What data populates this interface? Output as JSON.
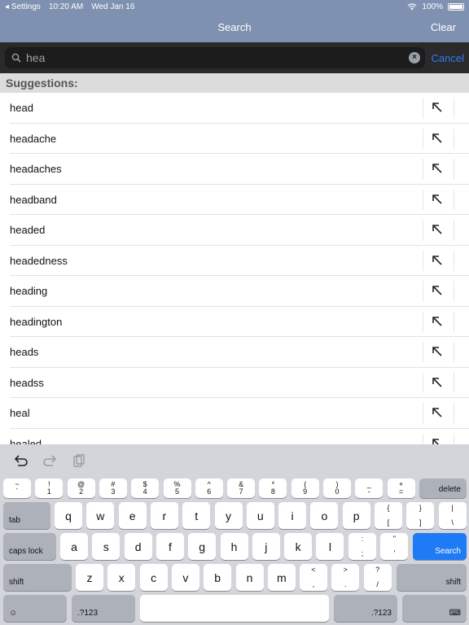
{
  "status_bar": {
    "back_label": "◂ Settings",
    "time": "10:20 AM",
    "date": "Wed Jan 16",
    "battery": "100%"
  },
  "nav": {
    "title": "Search",
    "clear_label": "Clear"
  },
  "search": {
    "value": "hea",
    "cancel_label": "Cancel"
  },
  "suggestions": {
    "header": "Suggestions:",
    "items": [
      "head",
      "headache",
      "headaches",
      "headband",
      "headed",
      "headedness",
      "heading",
      "headington",
      "heads",
      "headss",
      "heal",
      "healed"
    ]
  },
  "keyboard": {
    "row1": [
      {
        "top": "~",
        "bot": "`"
      },
      {
        "top": "!",
        "bot": "1"
      },
      {
        "top": "@",
        "bot": "2"
      },
      {
        "top": "#",
        "bot": "3"
      },
      {
        "top": "$",
        "bot": "4"
      },
      {
        "top": "%",
        "bot": "5"
      },
      {
        "top": "^",
        "bot": "6"
      },
      {
        "top": "&",
        "bot": "7"
      },
      {
        "top": "*",
        "bot": "8"
      },
      {
        "top": "(",
        "bot": "9"
      },
      {
        "top": ")",
        "bot": "0"
      },
      {
        "top": "_",
        "bot": "-"
      },
      {
        "top": "+",
        "bot": "="
      }
    ],
    "delete": "delete",
    "tab": "tab",
    "row2": [
      "q",
      "w",
      "e",
      "r",
      "t",
      "y",
      "u",
      "i",
      "o",
      "p"
    ],
    "row2_extra": [
      {
        "top": "{",
        "bot": "["
      },
      {
        "top": "}",
        "bot": "]"
      },
      {
        "top": "|",
        "bot": "\\"
      }
    ],
    "caps_lock": "caps lock",
    "row3": [
      "a",
      "s",
      "d",
      "f",
      "g",
      "h",
      "j",
      "k",
      "l"
    ],
    "row3_extra": [
      {
        "top": ":",
        "bot": ";"
      },
      {
        "top": "\"",
        "bot": "'"
      }
    ],
    "search": "Search",
    "shift": "shift",
    "row4": [
      "z",
      "x",
      "c",
      "v",
      "b",
      "n",
      "m"
    ],
    "row4_extra": [
      {
        "top": "<",
        "bot": ","
      },
      {
        "top": ">",
        "bot": "."
      },
      {
        "top": "?",
        "bot": "/"
      }
    ],
    "numbers": ".?123",
    "emoji": "☺",
    "kb_icon": "⌨"
  }
}
